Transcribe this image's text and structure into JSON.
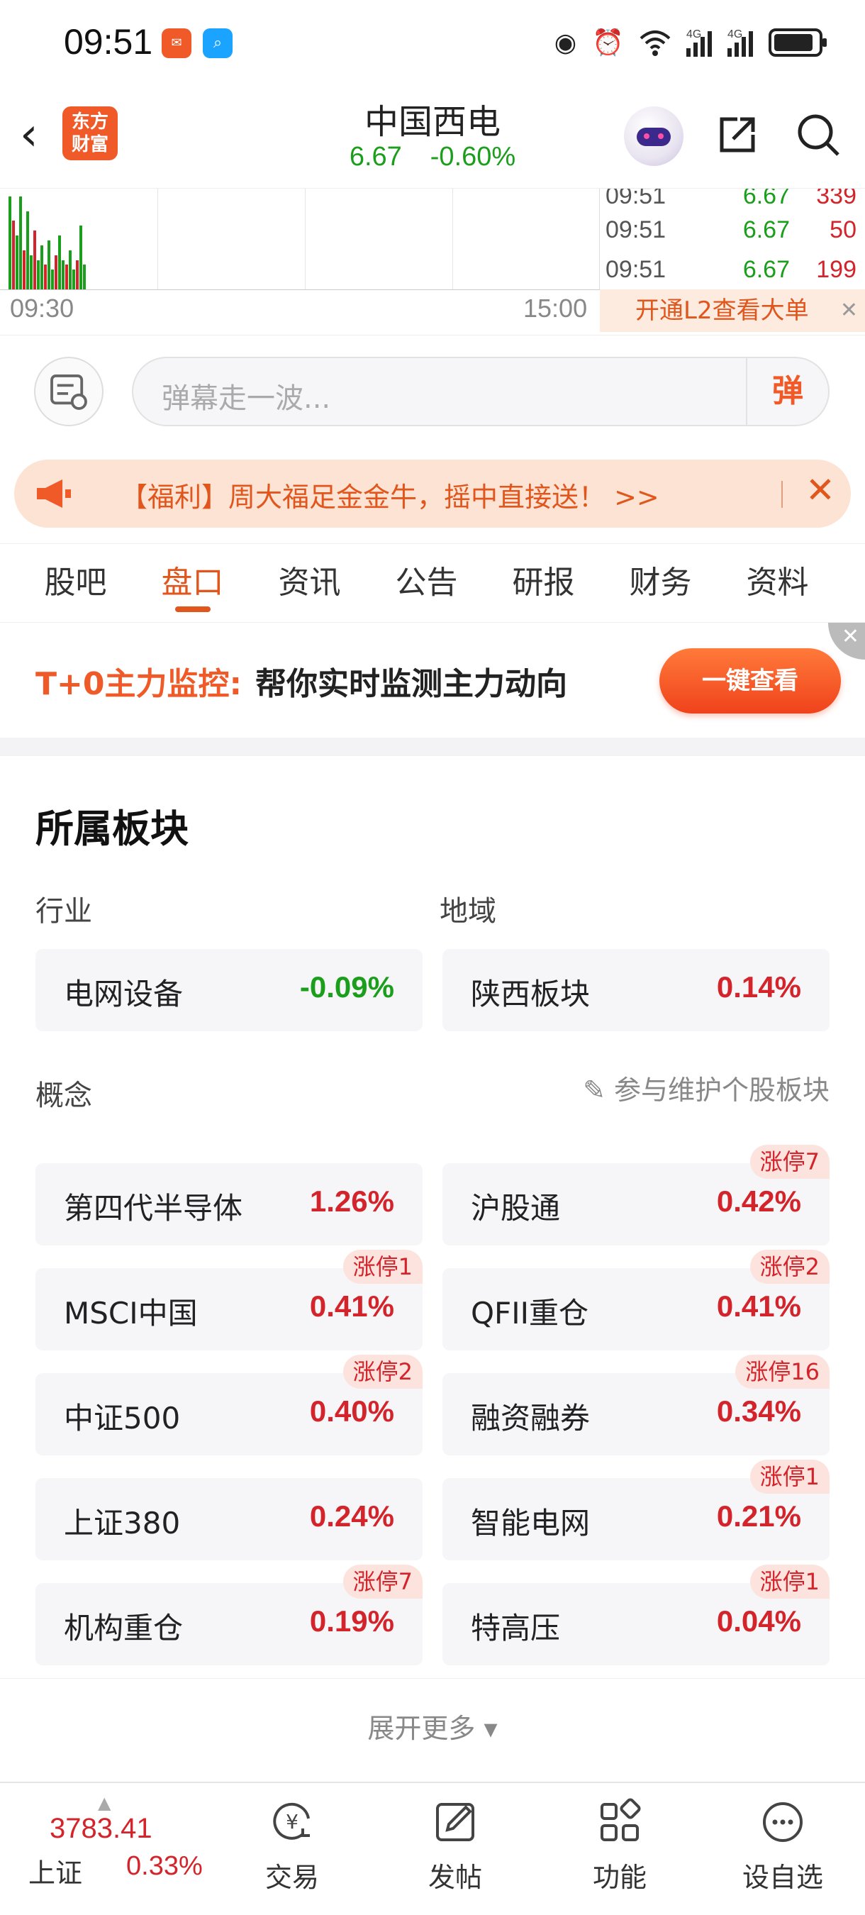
{
  "status_bar": {
    "time": "09:51",
    "net1": "4G",
    "net2": "4G",
    "battery_level": 0.9
  },
  "header": {
    "logo_text_1": "东方",
    "logo_text_2": "财富",
    "title": "中国西电",
    "price": "6.67",
    "change_pct": "-0.60%"
  },
  "chart": {
    "axis_start": "09:30",
    "axis_end": "15:00",
    "ticks": [
      {
        "time": "09:51",
        "price": "6.67",
        "vol": "339"
      },
      {
        "time": "09:51",
        "price": "6.67",
        "vol": "50"
      },
      {
        "time": "09:51",
        "price": "6.67",
        "vol": "199"
      }
    ],
    "l2_label": "开通L2查看大单",
    "volume_bars": [
      0.95,
      0.7,
      0.55,
      0.95,
      0.4,
      0.8,
      0.35,
      0.6,
      0.3,
      0.45,
      0.25,
      0.5,
      0.2,
      0.35,
      0.55,
      0.3,
      0.25,
      0.4,
      0.2,
      0.3,
      0.65,
      0.25
    ]
  },
  "danmu": {
    "placeholder": "弹幕走一波...",
    "send_label": "弹"
  },
  "promo": {
    "text": "【福利】周大福足金金牛，摇中直接送！ >>"
  },
  "tabs": [
    {
      "label": "股吧"
    },
    {
      "label": "盘口",
      "active": true
    },
    {
      "label": "资讯"
    },
    {
      "label": "公告"
    },
    {
      "label": "研报"
    },
    {
      "label": "财务"
    },
    {
      "label": "资料"
    }
  ],
  "banner": {
    "lead": "T+0主力监控:",
    "rest": "帮你实时监测主力动向",
    "button": "一键查看"
  },
  "sectors": {
    "title": "所属板块",
    "industry_label": "行业",
    "region_label": "地域",
    "concept_label": "概念",
    "maintain_label": "参与维护个股板块",
    "industry": {
      "name": "电网设备",
      "change": "-0.09%"
    },
    "region": {
      "name": "陕西板块",
      "change": "0.14%"
    },
    "concepts": [
      {
        "name": "第四代半导体",
        "change": "1.26%",
        "badge": ""
      },
      {
        "name": "沪股通",
        "change": "0.42%",
        "badge": "涨停7"
      },
      {
        "name": "MSCI中国",
        "change": "0.41%",
        "badge": "涨停1"
      },
      {
        "name": "QFII重仓",
        "change": "0.41%",
        "badge": "涨停2"
      },
      {
        "name": "中证500",
        "change": "0.40%",
        "badge": "涨停2"
      },
      {
        "name": "融资融券",
        "change": "0.34%",
        "badge": "涨停16"
      },
      {
        "name": "上证380",
        "change": "0.24%",
        "badge": ""
      },
      {
        "name": "智能电网",
        "change": "0.21%",
        "badge": "涨停1"
      },
      {
        "name": "机构重仓",
        "change": "0.19%",
        "badge": "涨停7"
      },
      {
        "name": "特高压",
        "change": "0.04%",
        "badge": "涨停1"
      }
    ],
    "more_label": "展开更多 ▾"
  },
  "bottom_bar": {
    "index_value": "3783.41",
    "index_name": "上证",
    "index_change": "0.33%",
    "items": [
      {
        "label": "交易",
        "icon": "trade-icon"
      },
      {
        "label": "发帖",
        "icon": "post-icon"
      },
      {
        "label": "功能",
        "icon": "apps-icon"
      },
      {
        "label": "设自选",
        "icon": "more-icon"
      }
    ]
  },
  "colors": {
    "up": "#d4242b",
    "down": "#1b9e1b",
    "brand": "#f05a28"
  }
}
